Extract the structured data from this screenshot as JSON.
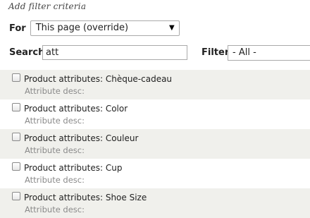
{
  "header": {
    "title": "Add filter criteria"
  },
  "for": {
    "label": "For",
    "selected": "This page (override)",
    "arrow": "▼"
  },
  "search": {
    "label": "Search",
    "value": "att"
  },
  "filter": {
    "label": "Filter",
    "selected": "- All -"
  },
  "items": [
    {
      "label": "Product attributes: Chèque-cadeau",
      "desc": "Attribute desc:"
    },
    {
      "label": "Product attributes: Color",
      "desc": "Attribute desc:"
    },
    {
      "label": "Product attributes: Couleur",
      "desc": "Attribute desc:"
    },
    {
      "label": "Product attributes: Cup",
      "desc": "Attribute desc:"
    },
    {
      "label": "Product attributes: Shoe Size",
      "desc": "Attribute desc:"
    }
  ]
}
